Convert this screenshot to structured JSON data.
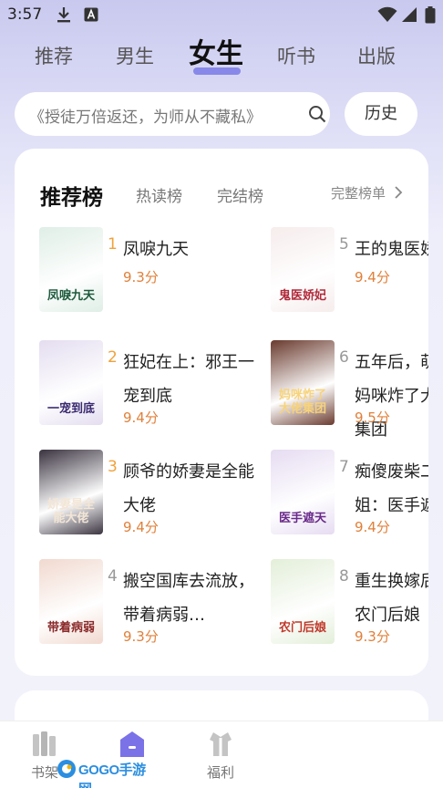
{
  "status_bar": {
    "time": "3:57",
    "icons": [
      "download-icon",
      "a-text-icon",
      "wifi-icon",
      "signal-icon",
      "battery-icon"
    ]
  },
  "top_tabs": [
    {
      "label": "推荐",
      "active": false
    },
    {
      "label": "男生",
      "active": false
    },
    {
      "label": "女生",
      "active": true
    },
    {
      "label": "听书",
      "active": false
    },
    {
      "label": "出版",
      "active": false
    }
  ],
  "search": {
    "placeholder": "《授徒万倍返还，为师从不藏私》",
    "icon": "search-icon",
    "history_label": "历史"
  },
  "ranking": {
    "title": "推荐榜",
    "tabs": [
      "热读榜",
      "完结榜"
    ],
    "full_list_label": "完整榜单",
    "books": [
      {
        "rank": "1",
        "title": "凤唳九天",
        "score": "9.3分",
        "cover_text": "凤唳九天",
        "cover_bg": "#dfeee6",
        "cover_fg": "#1d5a3c"
      },
      {
        "rank": "2",
        "title": "狂妃在上：邪王一宠到底",
        "score": "9.4分",
        "cover_text": "一宠到底",
        "cover_bg": "#e4ddf0",
        "cover_fg": "#3a2a70"
      },
      {
        "rank": "3",
        "title": "顾爷的娇妻是全能大佬",
        "score": "9.4分",
        "cover_text": "娇妻是全能大佬",
        "cover_bg": "#3a3340",
        "cover_fg": "#f3e6d6"
      },
      {
        "rank": "4",
        "title": "搬空国库去流放，带着病弱…",
        "score": "9.3分",
        "cover_text": "带着病弱",
        "cover_bg": "#f1d9cf",
        "cover_fg": "#8a2a2a"
      },
      {
        "rank": "5",
        "title": "王的鬼医娇",
        "score": "9.4分",
        "cover_text": "鬼医娇妃",
        "cover_bg": "#f6ecec",
        "cover_fg": "#b02a3a"
      },
      {
        "rank": "6",
        "title": "五年后，萌宝妈咪炸了大佬集团",
        "score": "9.5分",
        "cover_text": "妈咪炸了大佬集团",
        "cover_bg": "#6a3a2e",
        "cover_fg": "#f7d37a"
      },
      {
        "rank": "7",
        "title": "痴傻废柴二小姐：医手遮天",
        "score": "9.4分",
        "cover_text": "医手遮天",
        "cover_bg": "#e6dcf2",
        "cover_fg": "#6a2a8a"
      },
      {
        "rank": "8",
        "title": "重生换嫁后，农门后娘",
        "score": "9.3分",
        "cover_text": "农门后娘",
        "cover_bg": "#e3efd9",
        "cover_fg": "#c0392b"
      }
    ]
  },
  "bottom_nav": [
    {
      "label": "书架",
      "icon": "bookshelf-icon",
      "active": false
    },
    {
      "label": "",
      "icon": "home-icon",
      "active": true
    },
    {
      "label": "福利",
      "icon": "gift-icon",
      "active": false
    }
  ],
  "watermark": {
    "text": "GOGO手游网"
  },
  "colors": {
    "accent": "#7a7ae6",
    "score": "#e0803a",
    "rank_top": "#f0a23a",
    "rank_other": "#999999",
    "nav_active": "#7b72e8"
  }
}
